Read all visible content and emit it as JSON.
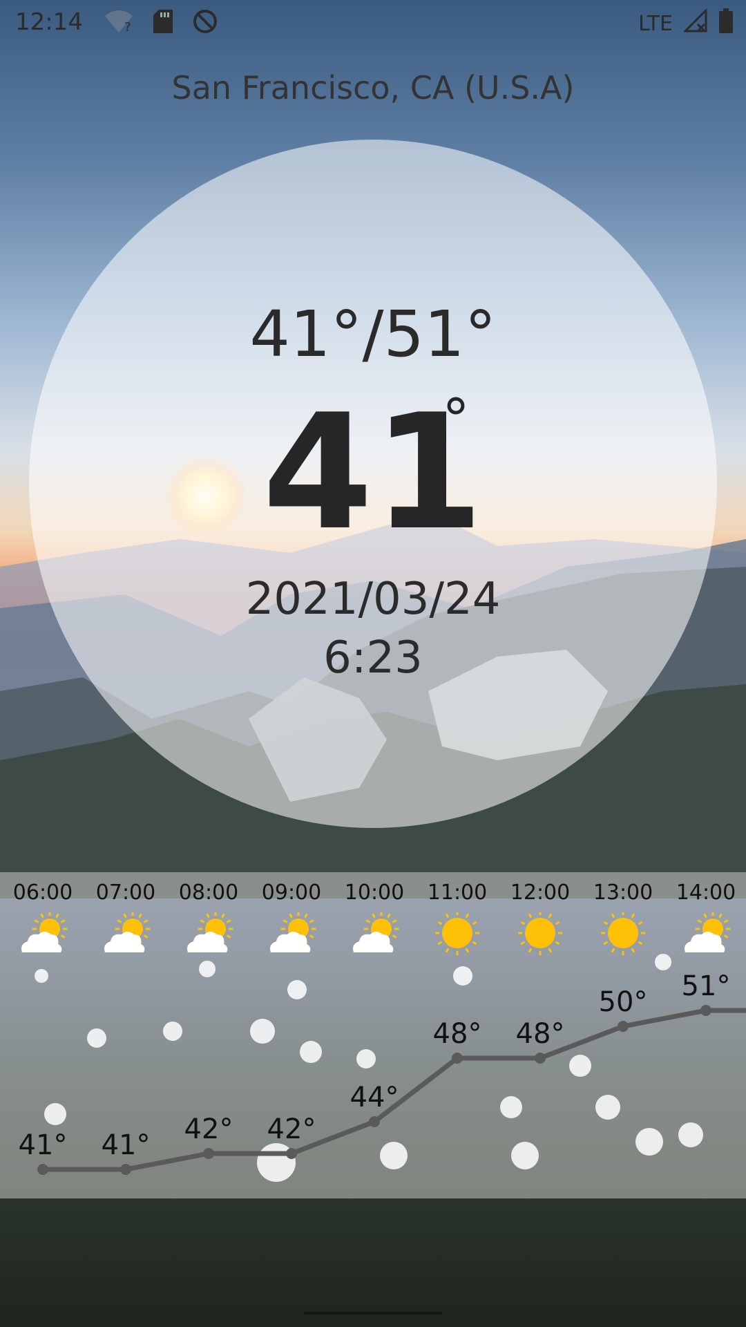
{
  "status": {
    "time": "12:14",
    "network": "LTE",
    "left_icons": [
      "wifi-question-icon",
      "sd-card-icon",
      "sync-disabled-icon"
    ],
    "right_icons": [
      "signal-icon",
      "battery-icon"
    ]
  },
  "location": "San Francisco, CA (U.S.A)",
  "current": {
    "range": "41°/51°",
    "temp": "41",
    "degree": "°",
    "date": "2021/03/24",
    "time": "6:23"
  },
  "hourly": {
    "hours": [
      "06:00",
      "07:00",
      "08:00",
      "09:00",
      "10:00",
      "11:00",
      "12:00",
      "13:00",
      "14:00"
    ],
    "icons": [
      "partly-cloudy-icon",
      "partly-cloudy-icon",
      "partly-cloudy-icon",
      "partly-cloudy-icon",
      "partly-cloudy-icon",
      "sun-icon",
      "sun-icon",
      "sun-icon",
      "partly-cloudy-icon"
    ],
    "temps": [
      41,
      41,
      42,
      42,
      44,
      48,
      48,
      50,
      51
    ],
    "temp_labels": [
      "41°",
      "41°",
      "42°",
      "42°",
      "44°",
      "48°",
      "48°",
      "50°",
      "51°"
    ]
  },
  "colors": {
    "line": "#5a5a5a",
    "sun": "#ffc107",
    "cloud": "#ffffff"
  }
}
